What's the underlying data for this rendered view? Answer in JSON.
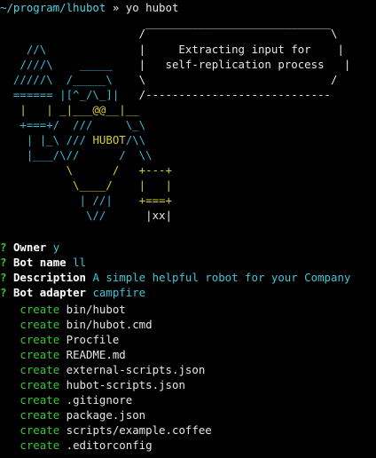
{
  "prompt": {
    "path": "~/program/lhubot",
    "separator": " » ",
    "command": "yo hubot"
  },
  "speech": {
    "line1": "Extracting input for",
    "line2": "self-replication process"
  },
  "robot_label": "HUBOT",
  "questions": [
    {
      "mark": "?",
      "label": "Owner",
      "answer": "y"
    },
    {
      "mark": "?",
      "label": "Bot name",
      "answer": "ll"
    },
    {
      "mark": "?",
      "label": "Description",
      "answer": "A simple helpful robot for your Company"
    },
    {
      "mark": "?",
      "label": "Bot adapter",
      "answer": "campfire"
    }
  ],
  "created": {
    "verb": "create",
    "files": [
      "bin/hubot",
      "bin/hubot.cmd",
      "Procfile",
      "README.md",
      "external-scripts.json",
      "hubot-scripts.json",
      ".gitignore",
      "package.json",
      "scripts/example.coffee",
      ".editorconfig"
    ]
  },
  "colors": {
    "background": "#000000",
    "path": "#4fd0e0",
    "robot": "#3fb8d4",
    "robot_accent": "#d4cf28",
    "question_mark": "#34c834",
    "answer": "#3ec6d6",
    "create": "#34c834"
  }
}
